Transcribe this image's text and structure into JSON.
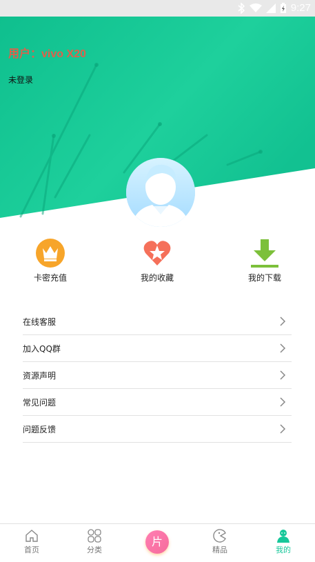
{
  "status_bar": {
    "time": "9:27"
  },
  "header": {
    "user_name": "用户：vivo X20",
    "login_state": "未登录"
  },
  "quick_actions": [
    {
      "label": "卡密充值",
      "icon": "crown-icon"
    },
    {
      "label": "我的收藏",
      "icon": "heart-star-icon"
    },
    {
      "label": "我的下载",
      "icon": "download-icon"
    }
  ],
  "menu": [
    {
      "label": "在线客服"
    },
    {
      "label": "加入QQ群"
    },
    {
      "label": "资源声明"
    },
    {
      "label": "常见问题"
    },
    {
      "label": "问题反馈"
    }
  ],
  "tabbar": {
    "tabs": [
      {
        "label": "首页",
        "icon": "home-icon"
      },
      {
        "label": "分类",
        "icon": "category-icon"
      },
      {
        "label": "精品",
        "icon": "pacman-icon"
      },
      {
        "label": "我的",
        "icon": "user-icon",
        "active": true
      }
    ],
    "center": {
      "label": "片"
    }
  },
  "colors": {
    "accent": "#17c79a",
    "hero_green": "#1cc596"
  }
}
